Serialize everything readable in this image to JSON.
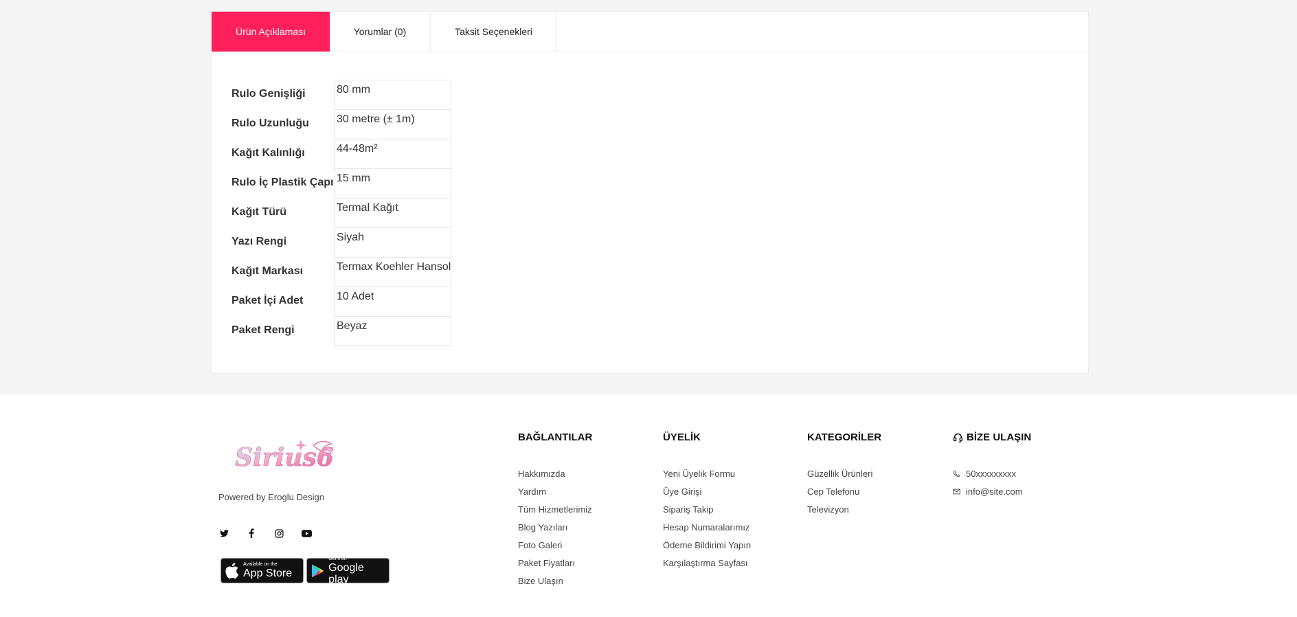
{
  "tabs": [
    {
      "label": "Ürün Açıklaması"
    },
    {
      "label": "Yorumlar (0)"
    },
    {
      "label": "Taksit Seçenekleri"
    }
  ],
  "accent_color": "#ff1f5a",
  "specs": [
    {
      "label": "Rulo Genişliği",
      "value": "80 mm"
    },
    {
      "label": "Rulo Uzunluğu",
      "value": "30 metre (± 1m)"
    },
    {
      "label": "Kağıt Kalınlığı",
      "value": "44-48m²"
    },
    {
      "label": "Rulo İç Plastik Çapı",
      "value": "15 mm"
    },
    {
      "label": "Kağıt Türü",
      "value": "Termal Kağıt"
    },
    {
      "label": "Yazı Rengi",
      "value": "Siyah"
    },
    {
      "label": "Kağıt Markası",
      "value": "Termax Koehler Hansol"
    },
    {
      "label": "Paket İçi Adet",
      "value": "10 Adet"
    },
    {
      "label": "Paket Rengi",
      "value": "Beyaz"
    }
  ],
  "footer": {
    "logo_text": "Sirius6",
    "powered": "Powered by Eroglu Design",
    "social": [
      "twitter-icon",
      "facebook-icon",
      "instagram-icon",
      "youtube-icon"
    ],
    "stores": {
      "apple_small": "Available on the",
      "apple_big": "App Store",
      "google_small": "Get it on",
      "google_big": "Google play"
    },
    "links": {
      "title": "BAĞLANTILAR",
      "items": [
        "Hakkımızda",
        "Yardım",
        "Tüm Hizmetlerimiz",
        "Blog Yazıları",
        "Foto Galeri",
        "Paket Fiyatları",
        "Bize Ulaşın"
      ]
    },
    "membership": {
      "title": "ÜYELİK",
      "items": [
        "Yeni Üyelik Formu",
        "Üye Girişi",
        "Sipariş Takip",
        "Hesap Numaralarımız",
        "Ödeme Bildirimi Yapın",
        "Karşılaştırma Sayfası"
      ]
    },
    "categories": {
      "title": "KATEGORİLER",
      "items": [
        "Güzellik Ürünleri",
        "Cep Telefonu",
        "Televizyon"
      ]
    },
    "contact": {
      "title": "BİZE ULAŞIN",
      "phone": "50xxxxxxxxx",
      "email": "info@site.com"
    }
  }
}
